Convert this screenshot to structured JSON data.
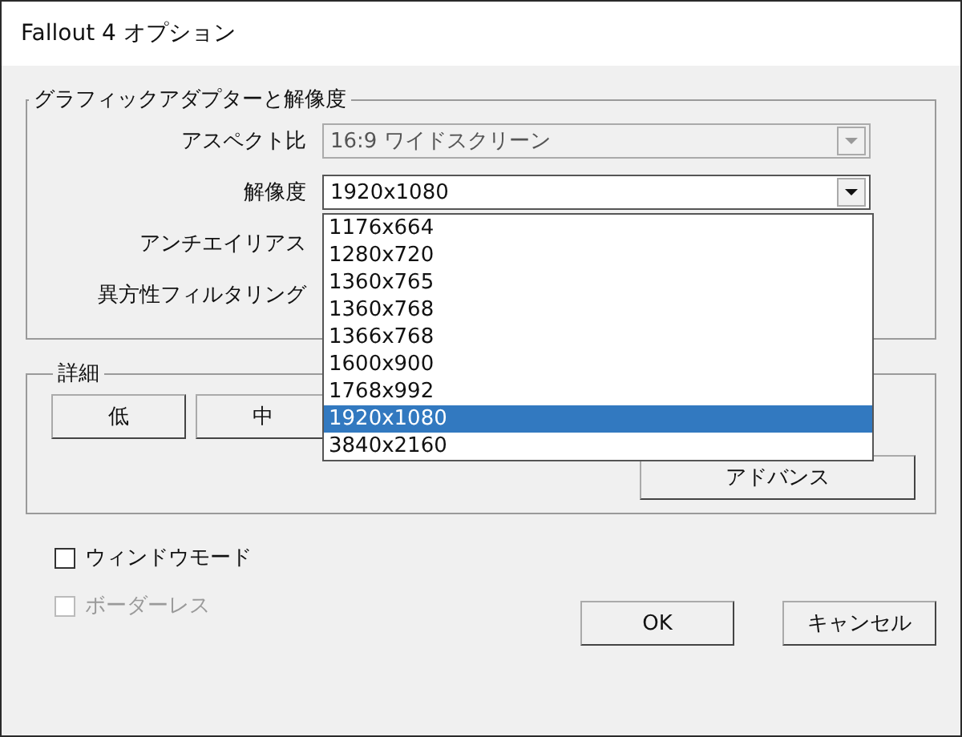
{
  "window": {
    "title": "Fallout 4 オプション"
  },
  "graphics": {
    "legend": "グラフィックアダプターと解像度",
    "rows": [
      {
        "label": "アスペクト比",
        "kind": "combo",
        "value": "16:9 ワイドスクリーン",
        "disabled": true
      },
      {
        "label": "解像度",
        "kind": "combo",
        "value": "1920x1080",
        "disabled": false,
        "expanded": true
      },
      {
        "label": "アンチエイリアス",
        "kind": "label"
      },
      {
        "label": "異方性フィルタリング",
        "kind": "label"
      }
    ],
    "resolution_options": [
      {
        "label": "1176x664",
        "selected": false
      },
      {
        "label": "1280x720",
        "selected": false
      },
      {
        "label": "1360x765",
        "selected": false
      },
      {
        "label": "1360x768",
        "selected": false
      },
      {
        "label": "1366x768",
        "selected": false
      },
      {
        "label": "1600x900",
        "selected": false
      },
      {
        "label": "1768x992",
        "selected": false
      },
      {
        "label": "1920x1080",
        "selected": true
      },
      {
        "label": "3840x2160",
        "selected": false
      }
    ]
  },
  "details": {
    "legend": "詳細",
    "quality_buttons": [
      "低",
      "中"
    ],
    "advanced_button": "アドバンス"
  },
  "checkboxes": [
    {
      "label": "ウィンドウモード",
      "checked": false,
      "disabled": false
    },
    {
      "label": "ボーダーレス",
      "checked": false,
      "disabled": true
    }
  ],
  "buttons": [
    "OK",
    "キャンセル"
  ]
}
